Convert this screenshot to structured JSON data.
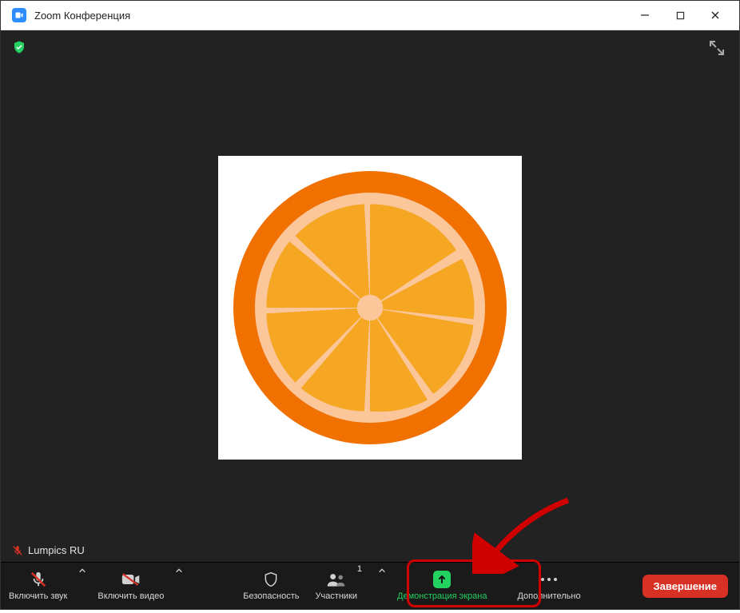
{
  "window": {
    "title": "Zoom Конференция"
  },
  "participant": {
    "name": "Lumpics RU"
  },
  "participants_count": "1",
  "toolbar": {
    "audio": "Включить звук",
    "video": "Включить видео",
    "security": "Безопасность",
    "participants": "Участники",
    "share": "Демонстрация экрана",
    "more": "Дополнительно",
    "end": "Завершение"
  },
  "colors": {
    "accent_green": "#23d160",
    "zoom_blue": "#2D8CFF",
    "danger_red": "#d93025",
    "highlight_red": "#d00000",
    "bg_dark": "#222222"
  }
}
